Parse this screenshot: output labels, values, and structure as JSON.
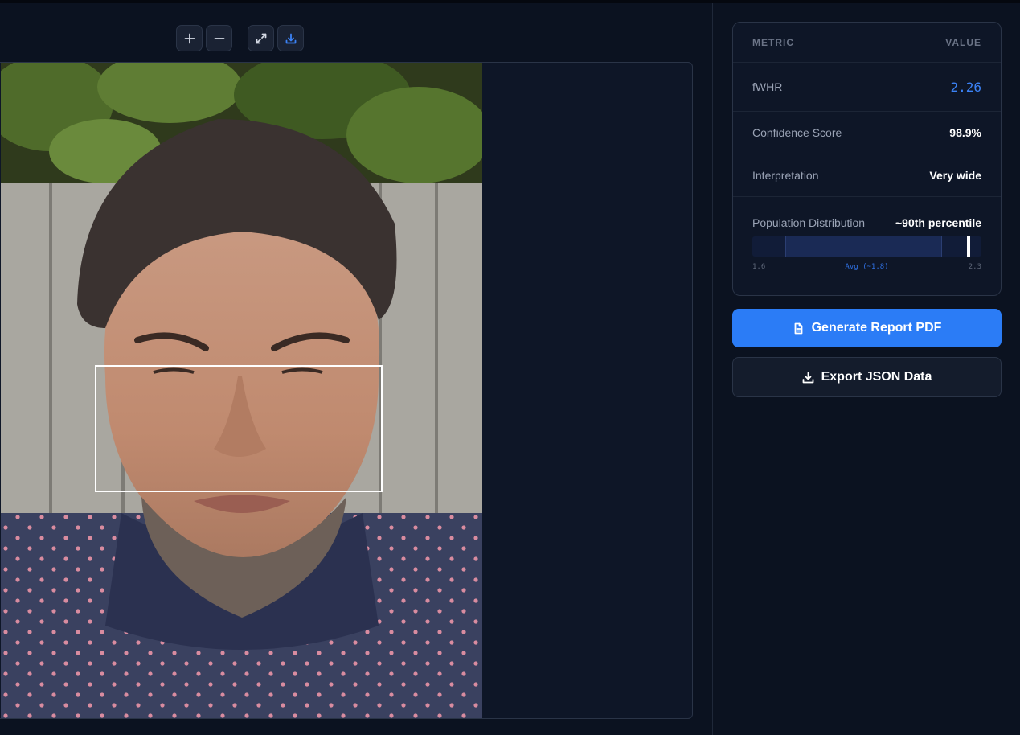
{
  "toolbar": {
    "zoom_in_icon": "plus-icon",
    "zoom_out_icon": "minus-icon",
    "fullscreen_icon": "expand-icon",
    "download_icon": "download-icon",
    "accent_color": "#3b82f6"
  },
  "viewer": {
    "image_alt": "Face photo with measurement box",
    "box_color": "#ffffff"
  },
  "metrics": {
    "header_metric": "METRIC",
    "header_value": "VALUE",
    "rows": [
      {
        "label": "fWHR",
        "value": "2.26"
      },
      {
        "label": "Confidence Score",
        "value": "98.9%"
      },
      {
        "label": "Interpretation",
        "value": "Very wide"
      }
    ],
    "distribution": {
      "label": "Population Distribution",
      "value": "~90th percentile",
      "min_label": "1.6",
      "avg_label": "Avg (~1.8)",
      "max_label": "2.3",
      "range_min": 1.6,
      "range_max": 2.3,
      "avg_band": [
        1.7,
        2.18
      ],
      "marker_value": 2.26
    }
  },
  "actions": {
    "generate_pdf": "Generate Report PDF",
    "export_json": "Export JSON Data",
    "primary_color": "#2b7cf6"
  }
}
